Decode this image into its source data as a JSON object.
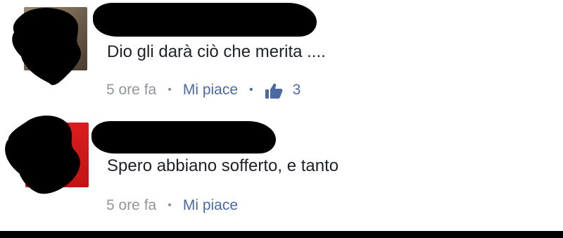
{
  "comments": [
    {
      "text": "Dio gli darà ciò che merita ....",
      "time": "5 ore fa",
      "like_label": "Mi piace",
      "like_count": "3",
      "like_icon": "thumbs-up-icon"
    },
    {
      "text": "Spero abbiano sofferto, e tanto",
      "time": "5 ore fa",
      "like_label": "Mi piace"
    }
  ],
  "colors": {
    "text": "#1d2129",
    "meta_gray": "#90949c",
    "link_blue": "#4b6aa3",
    "redaction": "#000000"
  }
}
